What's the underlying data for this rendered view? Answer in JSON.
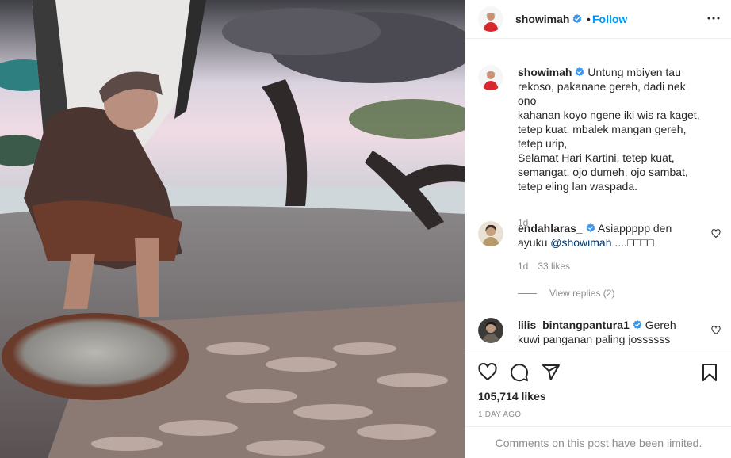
{
  "post": {
    "username": "showimah",
    "separator": "•",
    "follow_label": "Follow"
  },
  "caption": {
    "username": "showimah",
    "lines": [
      "Untung mbiyen tau",
      "rekoso, pakanane gereh, dadi nek ono",
      "kahanan koyo ngene iki wis ra kaget,",
      "tetep kuat, mbalek mangan gereh,",
      "tetep urip,",
      "Selamat Hari Kartini, tetep kuat,",
      "semangat, ojo dumeh, ojo sambat,",
      "tetep eling lan waspada."
    ],
    "time": "1d"
  },
  "comments": [
    {
      "username": "endahlaras_",
      "text_line1": "Asiappppp den",
      "text_line2_prefix": "ayuku ",
      "mention": "@showimah",
      "text_line2_suffix": " ....□□□□",
      "time": "1d",
      "likes": "33 likes",
      "view_replies": "View replies (2)"
    },
    {
      "username": "lilis_bintangpantura1",
      "text_line1": "Gereh",
      "text_line2": "kuwi panganan paling jossssss"
    }
  ],
  "stats": {
    "likes": "105,714 likes",
    "time_ago": "1 DAY AGO",
    "limited_notice": "Comments on this post have been limited."
  },
  "colors": {
    "accent": "#0095f6",
    "verified": "#3897f0",
    "text": "#262626",
    "muted": "#8e8e8e"
  },
  "icons": [
    "more-options-icon",
    "verified-badge-icon",
    "heart-icon",
    "comment-icon",
    "share-icon",
    "bookmark-icon"
  ]
}
